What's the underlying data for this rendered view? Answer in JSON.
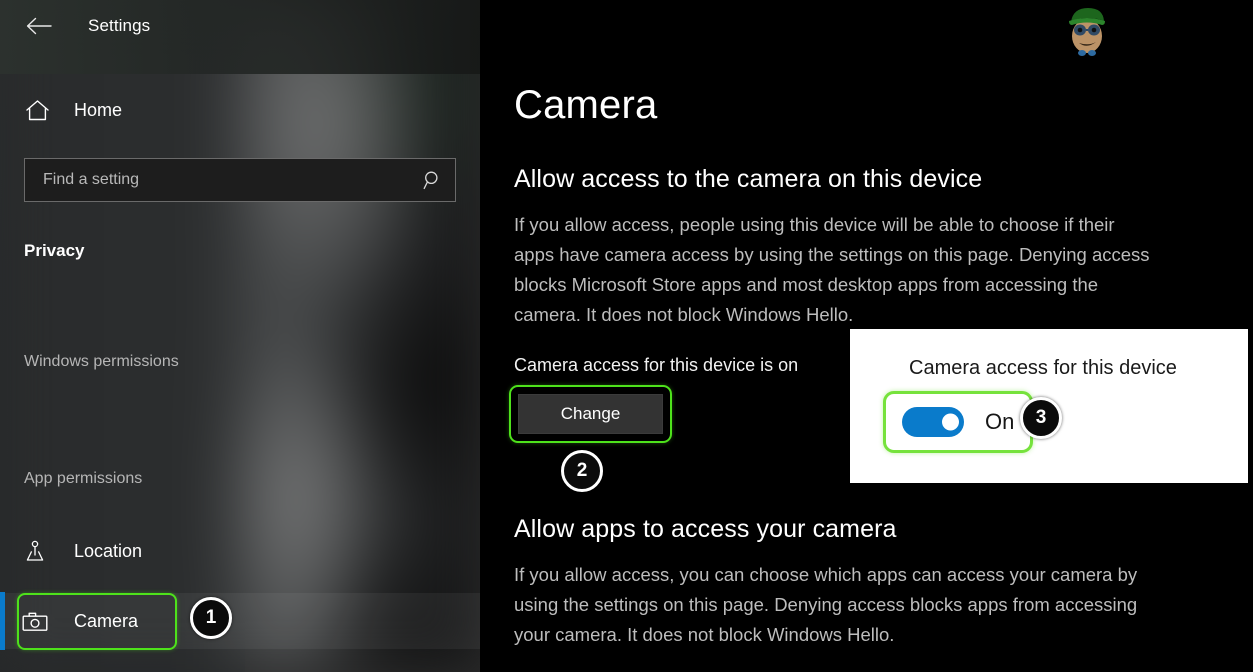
{
  "window": {
    "title": "Settings",
    "back_icon": "back-arrow-icon"
  },
  "sidebar": {
    "home": {
      "label": "Home",
      "icon": "home-icon"
    },
    "search": {
      "value": "",
      "placeholder": "Find a setting",
      "icon": "search-icon"
    },
    "group_title": "Privacy",
    "sections": [
      {
        "label": "Windows permissions",
        "type": "header"
      },
      {
        "label": "App permissions",
        "type": "header"
      }
    ],
    "items": [
      {
        "label": "Location",
        "icon": "location-icon",
        "selected": false
      },
      {
        "label": "Camera",
        "icon": "camera-icon",
        "selected": true
      }
    ],
    "accent_color": "#0a7bcb"
  },
  "main": {
    "page_title": "Camera",
    "section1": {
      "heading": "Allow access to the camera on this device",
      "body": "If you allow access, people using this device will be able to choose if their apps have camera access by using the settings on this page. Denying access blocks Microsoft Store apps and most desktop apps from accessing the camera. It does not block Windows Hello.",
      "status": "Camera access for this device is on",
      "change_button": "Change"
    },
    "section2": {
      "heading": "Allow apps to access your camera",
      "body": "If you allow access, you can choose which apps can access your camera by using the settings on this page. Denying access blocks apps from accessing your camera. It does not block Windows Hello."
    }
  },
  "popup": {
    "label": "Camera access for this device",
    "toggle_state": "On",
    "toggle_on": true,
    "toggle_color": "#0a7bcb"
  },
  "annotations": {
    "highlight_color": "#4ee21b",
    "badges": [
      {
        "number": "1",
        "target": "sidebar-item-camera"
      },
      {
        "number": "2",
        "target": "change-button"
      },
      {
        "number": "3",
        "target": "camera-access-toggle"
      }
    ]
  },
  "watermark": {
    "name": "appuals-mascot-logo"
  }
}
